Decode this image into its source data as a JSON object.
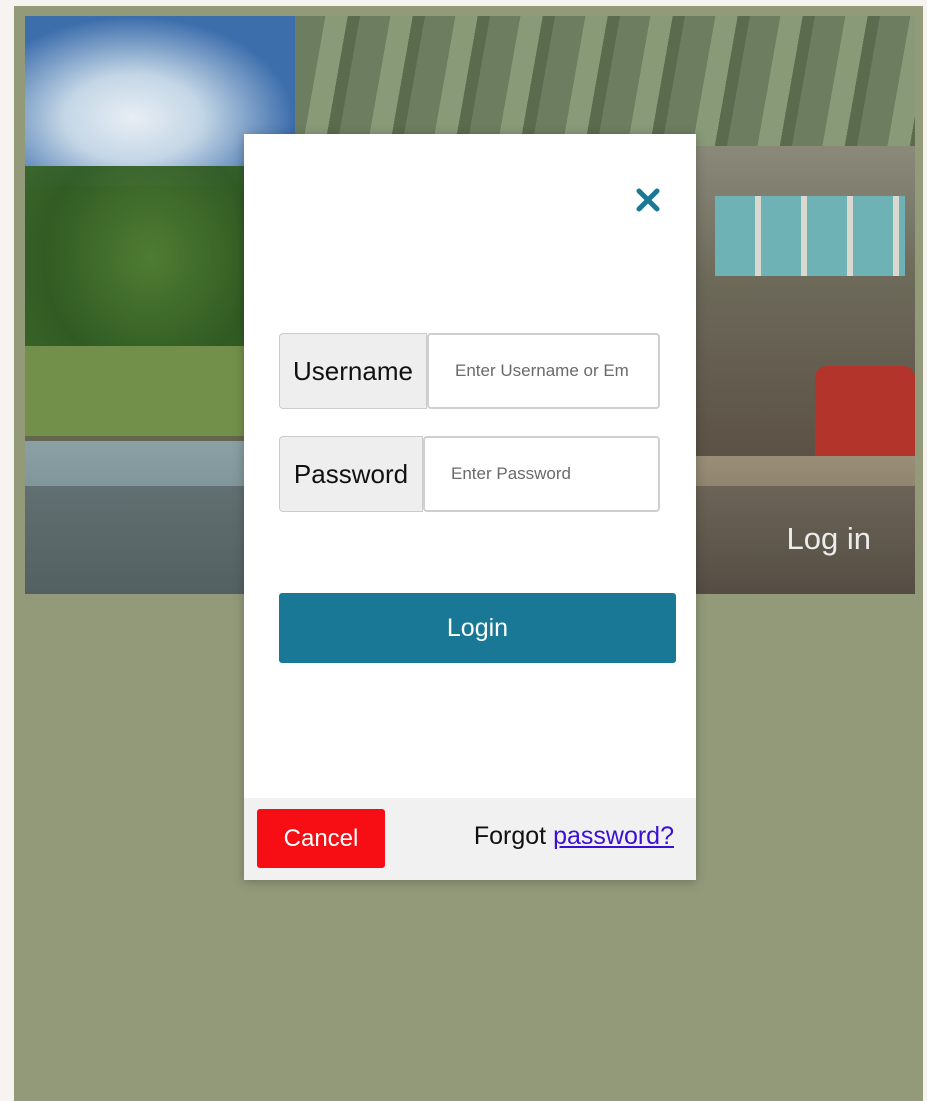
{
  "hero": {
    "title": "Log in"
  },
  "modal": {
    "close_icon": "close-icon",
    "username": {
      "label": "Username",
      "placeholder": "Enter Username or Em"
    },
    "password": {
      "label": "Password",
      "placeholder": "Enter Password"
    },
    "login_label": "Login",
    "cancel_label": "Cancel",
    "forgot_prefix": "Forgot",
    "forgot_link": "password?"
  },
  "colors": {
    "page_background": "#939a7a",
    "accent": "#187896",
    "cancel": "#f60e14",
    "link": "#3b10d6"
  }
}
